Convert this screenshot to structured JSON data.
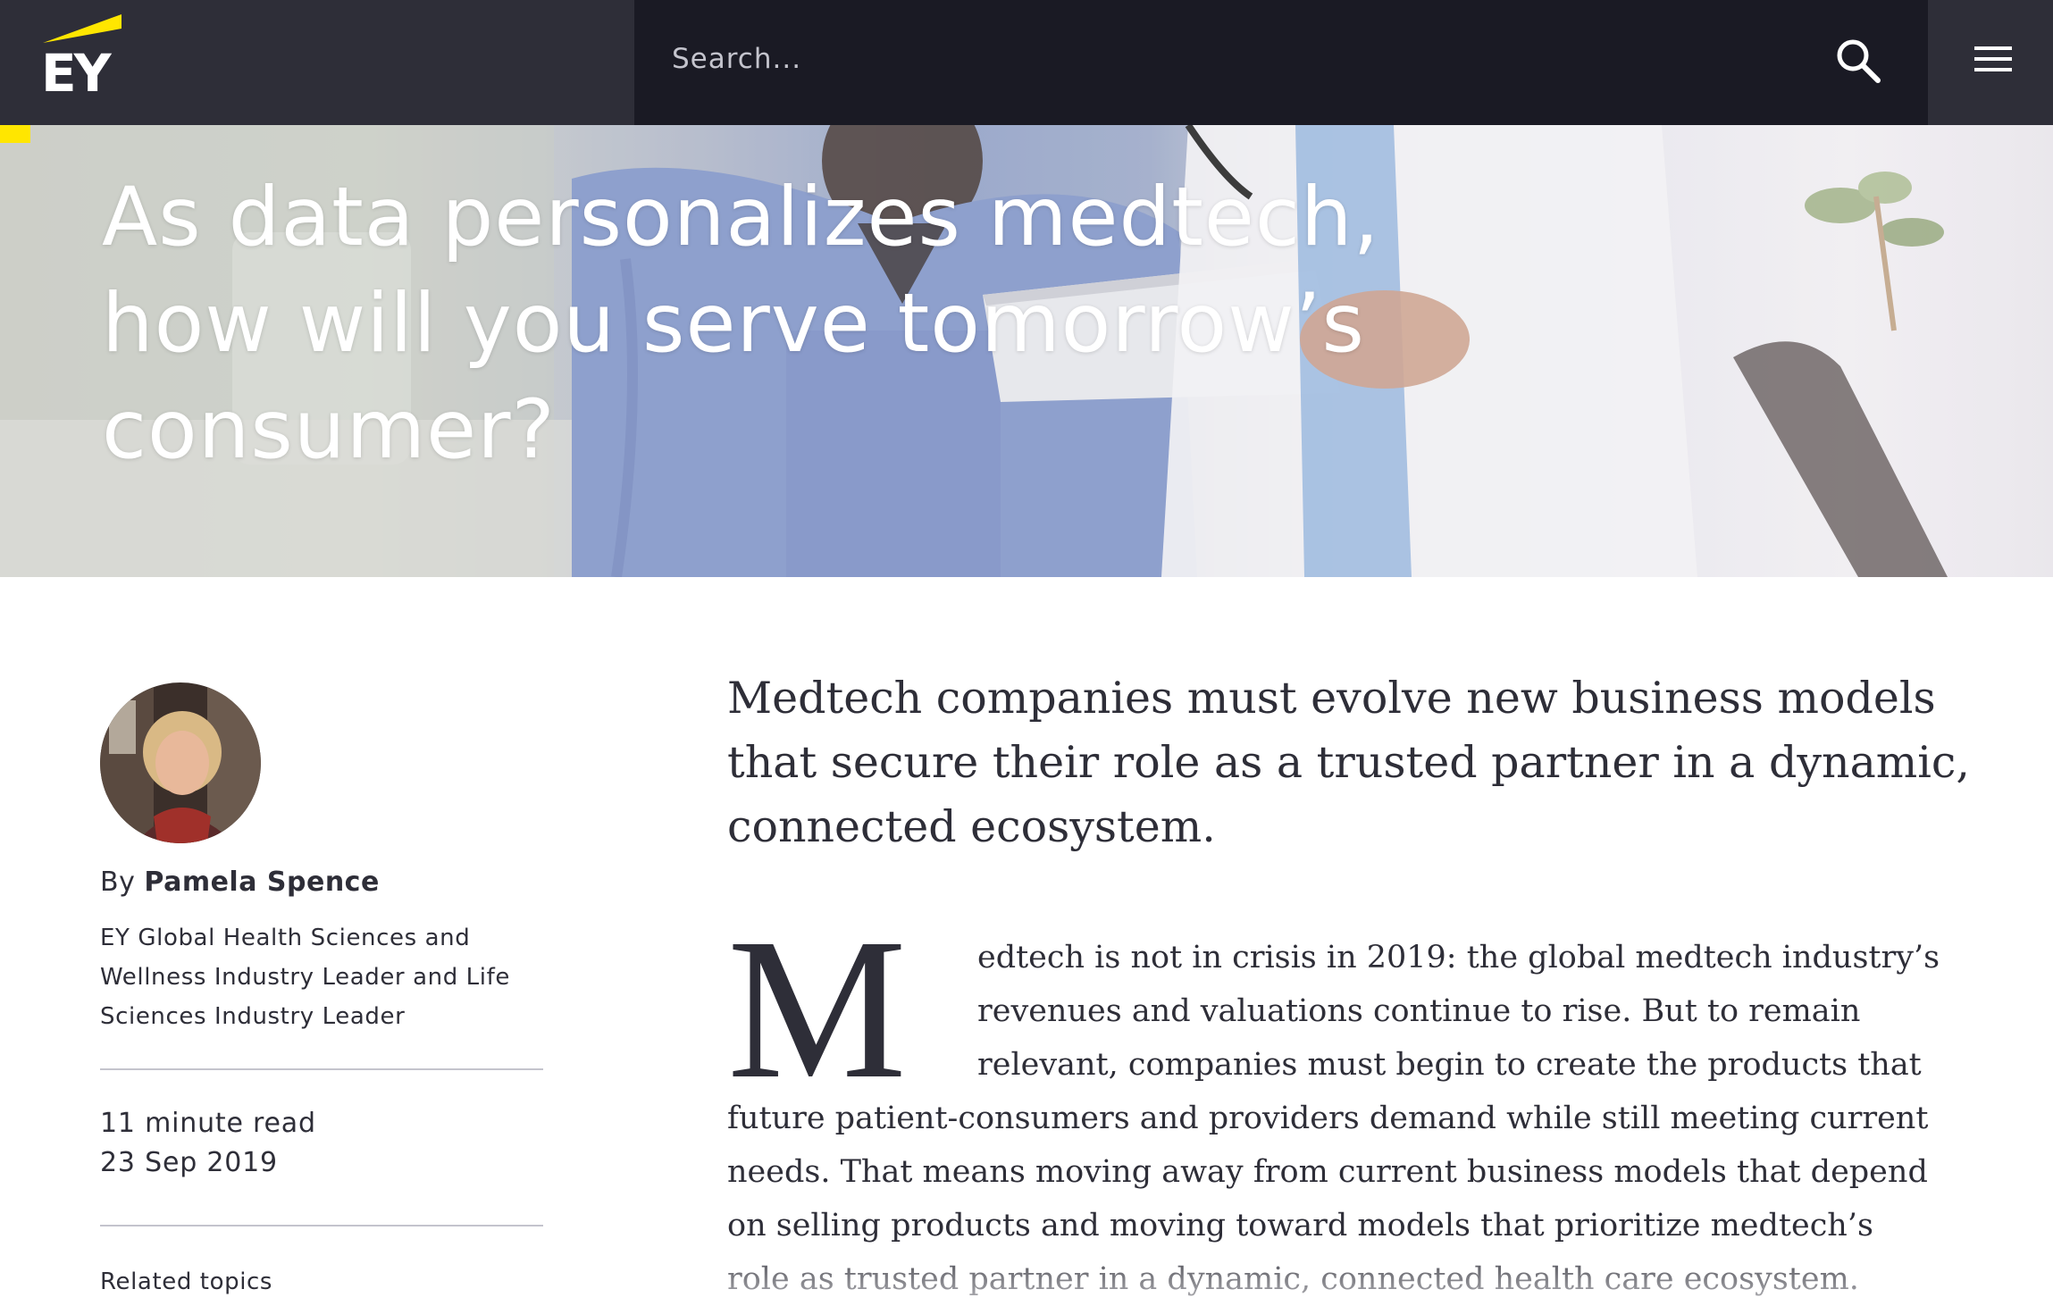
{
  "header": {
    "logo_text": "EY",
    "search_placeholder": "Search...",
    "search_icon": "search-icon",
    "menu_icon": "hamburger-menu-icon"
  },
  "hero": {
    "title": "As data personalizes medtech, how will you serve tomorrow’s consumer?",
    "accent_color": "#ffe600"
  },
  "author": {
    "by_label": "By",
    "name": "Pamela Spence",
    "role": "EY Global Health Sciences and Wellness Industry Leader and Life Sciences Industry Leader"
  },
  "meta": {
    "read_time": "11 minute read",
    "date": "23 Sep 2019",
    "related_topics_label": "Related topics"
  },
  "article": {
    "intro": "Medtech companies must evolve new business models that secure their role as a trusted partner in a dynamic, connected ecosystem.",
    "drop_cap": "M",
    "body": "edtech is not in crisis in 2019: the global medtech industry’s revenues and valuations continue to rise. But to remain relevant, companies must begin to create the products that future patient-consumers and providers demand while still meeting current needs. That means moving away from current business models that depend on selling products and moving toward models that prioritize medtech’s role as trusted partner in a dynamic, connected health care ecosystem."
  },
  "colors": {
    "header_bg": "#2e2e38",
    "search_bg": "#1a1a24",
    "text": "#2e2e38",
    "brand_yellow": "#ffe600"
  }
}
